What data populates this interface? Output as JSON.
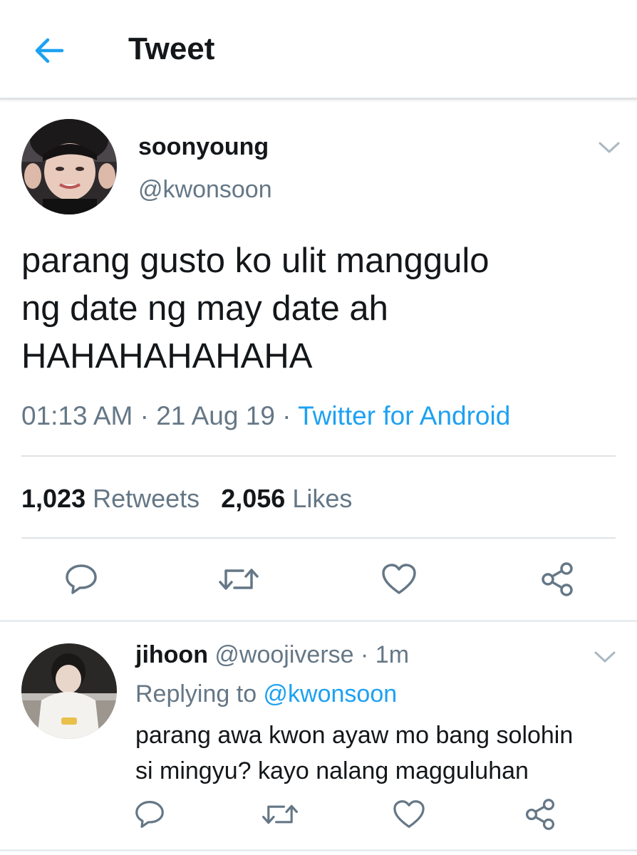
{
  "header": {
    "title": "Tweet",
    "back_icon": "arrow-left-icon"
  },
  "tweet": {
    "display_name": "soonyoung",
    "handle": "@kwonsoon",
    "text_lines": [
      "parang gusto ko ulit manggulo",
      "ng date ng may date ah",
      "HAHAHAHAHAHA"
    ],
    "time": "01:13 AM",
    "sep1": " · ",
    "date": "21 Aug 19",
    "sep2": " · ",
    "source": "Twitter for Android",
    "retweets_count": "1,023",
    "retweets_label": "Retweets",
    "likes_count": "2,056",
    "likes_label": "Likes"
  },
  "reply": {
    "display_name": "jihoon",
    "handle": "@woojiverse",
    "time_sep": " · ",
    "time": "1m",
    "replying_prefix": "Replying to ",
    "replying_to": "@kwonsoon",
    "text_lines": [
      "parang awa kwon ayaw mo bang solohin",
      "si mingyu? kayo nalang magguluhan"
    ]
  },
  "colors": {
    "accent": "#1da1f2",
    "muted": "#657786",
    "text": "#14171a",
    "divider": "#dfe3e6"
  },
  "icons": {
    "reply": "reply-icon",
    "retweet": "retweet-icon",
    "like": "heart-icon",
    "share": "share-icon",
    "caret": "chevron-down-icon"
  }
}
